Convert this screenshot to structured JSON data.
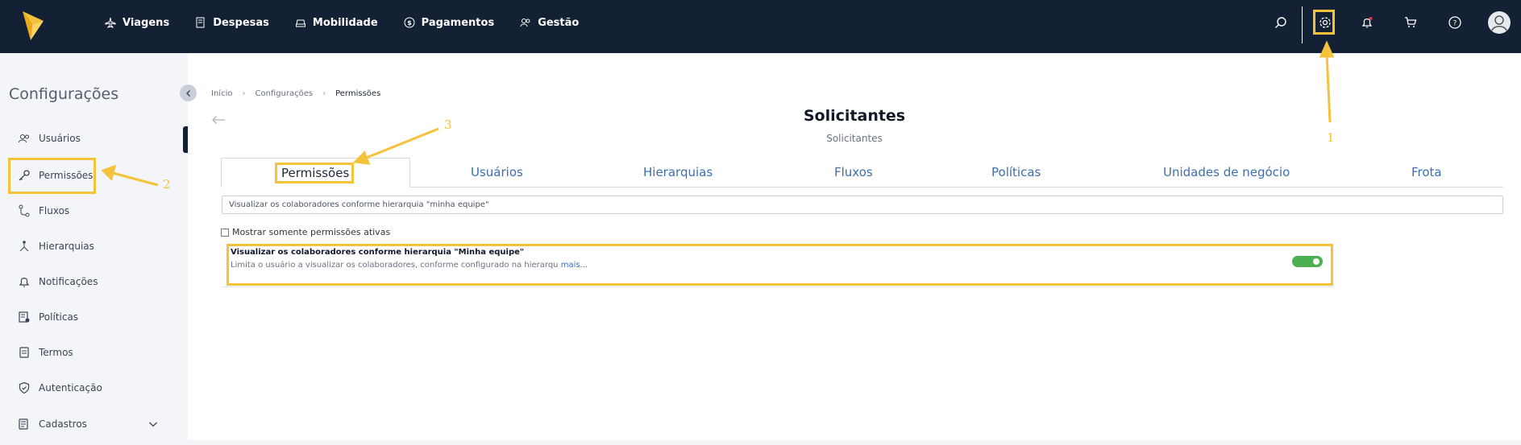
{
  "topnav": {
    "items": [
      {
        "label": "Viagens",
        "icon": "plane-icon"
      },
      {
        "label": "Despesas",
        "icon": "receipt-icon"
      },
      {
        "label": "Mobilidade",
        "icon": "car-icon"
      },
      {
        "label": "Pagamentos",
        "icon": "dollar-icon"
      },
      {
        "label": "Gestão",
        "icon": "users-icon"
      }
    ],
    "right_icons": [
      "search-icon",
      "gear-icon",
      "bell-icon",
      "cart-icon",
      "help-icon",
      "avatar-icon"
    ]
  },
  "sidebar": {
    "title": "Configurações",
    "items": [
      {
        "label": "Usuários",
        "icon": "users-icon"
      },
      {
        "label": "Permissões",
        "icon": "key-icon"
      },
      {
        "label": "Fluxos",
        "icon": "flow-icon"
      },
      {
        "label": "Hierarquias",
        "icon": "hierarchy-icon"
      },
      {
        "label": "Notificações",
        "icon": "bell-icon"
      },
      {
        "label": "Políticas",
        "icon": "policy-icon"
      },
      {
        "label": "Termos",
        "icon": "document-icon"
      },
      {
        "label": "Autenticação",
        "icon": "shield-icon"
      },
      {
        "label": "Cadastros",
        "icon": "folder-icon"
      }
    ]
  },
  "breadcrumb": {
    "items": [
      "Início",
      "Configurações",
      "Permissões"
    ]
  },
  "page": {
    "title": "Solicitantes",
    "subtitle": "Solicitantes"
  },
  "tabs": [
    {
      "label": "Permissões",
      "active": true
    },
    {
      "label": "Usuários",
      "active": false
    },
    {
      "label": "Hierarquias",
      "active": false
    },
    {
      "label": "Fluxos",
      "active": false
    },
    {
      "label": "Políticas",
      "active": false
    },
    {
      "label": "Unidades de negócio",
      "active": false
    },
    {
      "label": "Frota",
      "active": false
    }
  ],
  "search": {
    "value": "Visualizar os colaboradores conforme hierarquia \"minha equipe\""
  },
  "filter": {
    "label": "Mostrar somente permissões ativas",
    "checked": false
  },
  "permission": {
    "title": "Visualizar os colaboradores conforme hierarquia \"Minha equipe\"",
    "description": "Limita o usuário a visualizar os colaboradores, conforme configurado na hierarqu",
    "more_link": "mais...",
    "enabled": true
  },
  "annotations": {
    "one": "1",
    "two": "2",
    "three": "3"
  },
  "colors": {
    "topbar": "#142033",
    "highlight": "#f5c33b",
    "toggle_on": "#4caf50",
    "link": "#3b6fb0"
  }
}
